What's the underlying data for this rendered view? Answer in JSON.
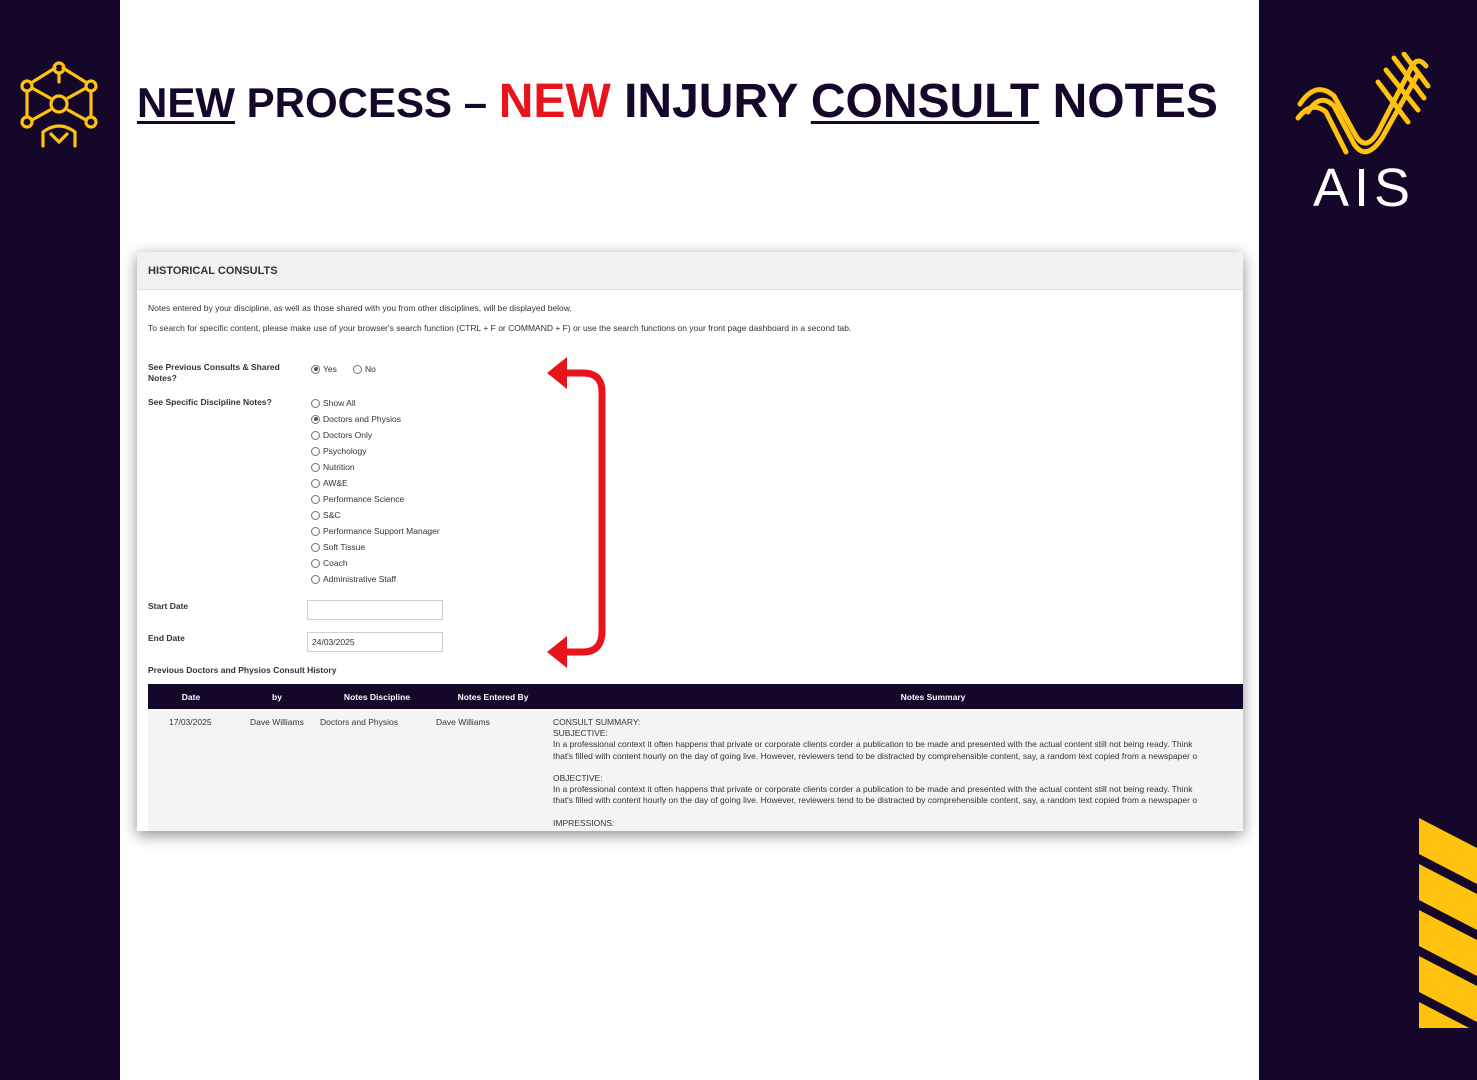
{
  "slide": {
    "title_part1": "NEW",
    "title_part2": " PROCESS – ",
    "title_part3": "NEW",
    "title_part4": " INJURY ",
    "title_part5": "CONSULT",
    "title_part6": " NOTES",
    "logo_text": "AIS"
  },
  "colors": {
    "navy": "#140729",
    "accent_red": "#e8141b",
    "gold": "#ffc20e"
  },
  "panel": {
    "title": "HISTORICAL CONSULTS",
    "info_line1": "Notes entered by your discipline, as well as those shared with you from other disciplines, will be displayed below.",
    "info_line2": "To search for specific content, please make use of your browser's search function (CTRL + F or COMMAND + F) or use the search functions on your front page dashboard in a second tab."
  },
  "form": {
    "previous_label_line1": "See Previous Consults & Shared",
    "previous_label_line2": "Notes?",
    "previous_options": [
      {
        "label": "Yes",
        "checked": true
      },
      {
        "label": "No",
        "checked": false
      }
    ],
    "discipline_label": "See Specific Discipline Notes?",
    "discipline_options": [
      {
        "label": "Show All",
        "checked": false
      },
      {
        "label": "Doctors and Physios",
        "checked": true
      },
      {
        "label": "Doctors Only",
        "checked": false
      },
      {
        "label": "Psychology",
        "checked": false
      },
      {
        "label": "Nutrition",
        "checked": false
      },
      {
        "label": "AW&E",
        "checked": false
      },
      {
        "label": "Performance Science",
        "checked": false
      },
      {
        "label": "S&C",
        "checked": false
      },
      {
        "label": "Performance Support Manager",
        "checked": false
      },
      {
        "label": "Soft Tissue",
        "checked": false
      },
      {
        "label": "Coach",
        "checked": false
      },
      {
        "label": "Administrative Staff",
        "checked": false
      }
    ],
    "start_date_label": "Start Date",
    "start_date_value": "",
    "end_date_label": "End Date",
    "end_date_value": "24/03/2025"
  },
  "history": {
    "title": "Previous Doctors and Physios Consult History",
    "columns": [
      "Date",
      "by",
      "Notes Discipline",
      "Notes Entered By",
      "Notes Summary"
    ],
    "rows": [
      {
        "date": "17/03/2025",
        "by": "Dave Williams",
        "discipline": "Doctors and Physios",
        "entered_by": "Dave Williams",
        "summary": "CONSULT SUMMARY:\nSUBJECTIVE:\nIn a professional context it often happens that private or corporate clients corder a publication to be made and presented with the actual content still not being ready. Think\nthat's filled with content hourly on the day of going live. However, reviewers tend to be distracted by comprehensible content, say, a random text copied from a newspaper o\n\nOBJECTIVE:\nIn a professional context it often happens that private or corporate clients corder a publication to be made and presented with the actual content still not being ready. Think\nthat's filled with content hourly on the day of going live. However, reviewers tend to be distracted by comprehensible content, say, a random text copied from a newspaper o\n\nIMPRESSIONS:\nIn a professional context it often happens that private or corporate clients corder a publication to be made and presented with the actual content still not being ready. Think"
      }
    ]
  }
}
